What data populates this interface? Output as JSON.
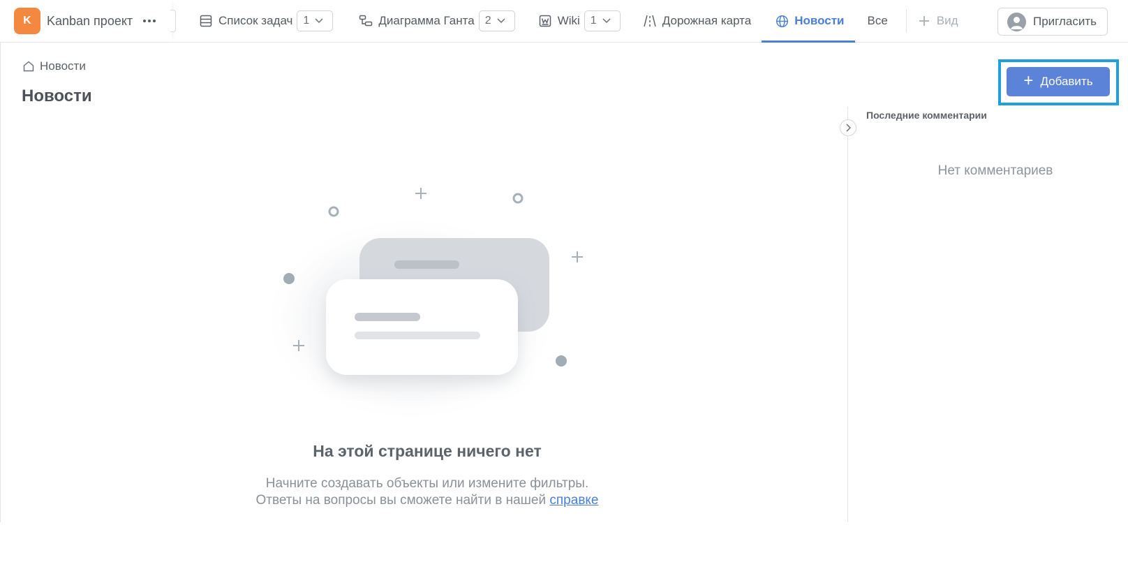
{
  "project": {
    "badge_letter": "K",
    "badge_color": "#f5883f",
    "name": "Kanban проект"
  },
  "tabs": [
    {
      "label": "Список задач",
      "icon": "list-icon",
      "count": "1"
    },
    {
      "label": "Диаграмма Ганта",
      "icon": "gantt-icon",
      "count": "2"
    },
    {
      "label": "Wiki",
      "icon": "wiki-icon",
      "count": "1"
    },
    {
      "label": "Дорожная карта",
      "icon": "road-icon"
    },
    {
      "label": "Новости",
      "icon": "globe-icon",
      "active": true
    },
    {
      "label": "Все"
    }
  ],
  "view_button": {
    "label": "Вид"
  },
  "invite_button": {
    "label": "Пригласить"
  },
  "breadcrumb": {
    "label": "Новости"
  },
  "page_title": "Новости",
  "add_button": {
    "label": "Добавить"
  },
  "comments_panel": {
    "title": "Последние комментарии",
    "empty_text": "Нет комментариев"
  },
  "empty_state": {
    "title": "На этой странице ничего нет",
    "line1": "Начните создавать объекты или измените фильтры.",
    "line2_prefix": "Ответы на вопросы вы сможете найти в нашей ",
    "help_link": "справке"
  },
  "colors": {
    "accent": "#4a7fd6",
    "add_button": "#5b83d8",
    "highlight_border": "#1d9fe0"
  }
}
